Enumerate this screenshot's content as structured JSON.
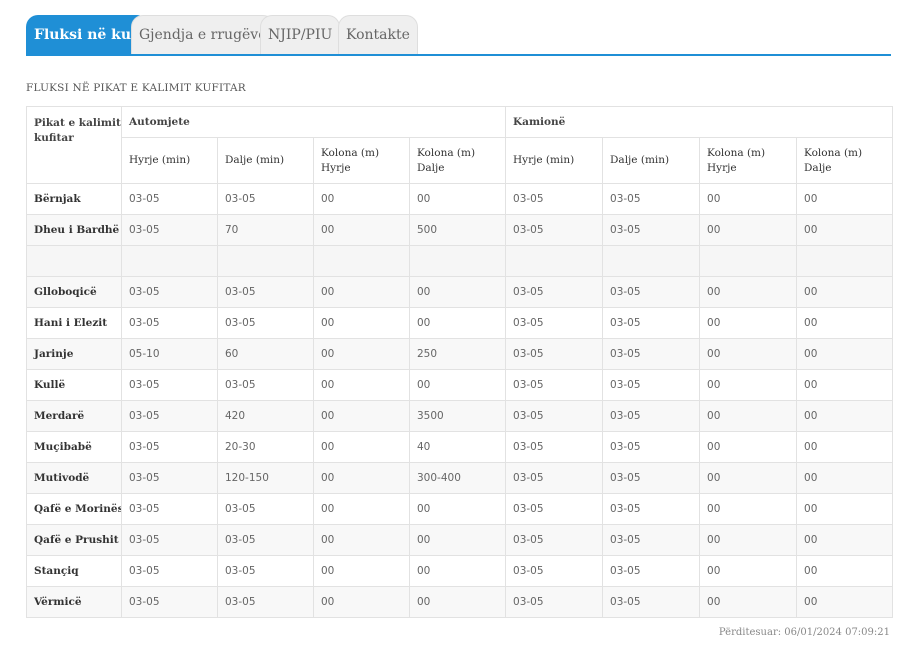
{
  "tabs": [
    {
      "label": "Fluksi në kufi",
      "active": true
    },
    {
      "label": "Gjendja e rrugëve",
      "active": false
    },
    {
      "label": "NJIP/PIU",
      "active": false
    },
    {
      "label": "Kontakte",
      "active": false
    }
  ],
  "section_title": "FLUKSI NË PIKAT E KALIMIT KUFITAR",
  "table": {
    "row_header": "Pikat e kalimit kufitar",
    "group_headers": [
      "Automjete",
      "Kamionë"
    ],
    "sub_headers": [
      "Hyrje (min)",
      "Dalje (min)",
      "Kolona (m) Hyrje",
      "Kolona (m) Dalje",
      "Hyrje (min)",
      "Dalje (min)",
      "Kolona (m) Hyrje",
      "Kolona (m) Dalje"
    ],
    "rows": [
      {
        "name": "Bërnjak",
        "values": [
          "03-05",
          "03-05",
          "00",
          "00",
          "03-05",
          "03-05",
          "00",
          "00"
        ]
      },
      {
        "name": "Dheu i Bardhë",
        "values": [
          "03-05",
          "70",
          "00",
          "500",
          "03-05",
          "03-05",
          "00",
          "00"
        ]
      },
      {
        "name": "",
        "values": [
          "",
          "",
          "",
          "",
          "",
          "",
          "",
          ""
        ]
      },
      {
        "name": "Glloboqicë",
        "values": [
          "03-05",
          "03-05",
          "00",
          "00",
          "03-05",
          "03-05",
          "00",
          "00"
        ]
      },
      {
        "name": "Hani i Elezit",
        "values": [
          "03-05",
          "03-05",
          "00",
          "00",
          "03-05",
          "03-05",
          "00",
          "00"
        ]
      },
      {
        "name": "Jarinje",
        "values": [
          "05-10",
          "60",
          "00",
          "250",
          "03-05",
          "03-05",
          "00",
          "00"
        ]
      },
      {
        "name": "Kullë",
        "values": [
          "03-05",
          "03-05",
          "00",
          "00",
          "03-05",
          "03-05",
          "00",
          "00"
        ]
      },
      {
        "name": "Merdarë",
        "values": [
          "03-05",
          "420",
          "00",
          "3500",
          "03-05",
          "03-05",
          "00",
          "00"
        ]
      },
      {
        "name": "Muçibabë",
        "values": [
          "03-05",
          "20-30",
          "00",
          "40",
          "03-05",
          "03-05",
          "00",
          "00"
        ]
      },
      {
        "name": "Mutivodë",
        "values": [
          "03-05",
          "120-150",
          "00",
          "300-400",
          "03-05",
          "03-05",
          "00",
          "00"
        ]
      },
      {
        "name": "Qafë e Morinës",
        "values": [
          "03-05",
          "03-05",
          "00",
          "00",
          "03-05",
          "03-05",
          "00",
          "00"
        ]
      },
      {
        "name": "Qafë e Prushit",
        "values": [
          "03-05",
          "03-05",
          "00",
          "00",
          "03-05",
          "03-05",
          "00",
          "00"
        ]
      },
      {
        "name": "Stançiq",
        "values": [
          "03-05",
          "03-05",
          "00",
          "00",
          "03-05",
          "03-05",
          "00",
          "00"
        ]
      },
      {
        "name": "Vërmicë",
        "values": [
          "03-05",
          "03-05",
          "00",
          "00",
          "03-05",
          "03-05",
          "00",
          "00"
        ]
      }
    ]
  },
  "updated": "Përditesuar: 06/01/2024 07:09:21",
  "colors": {
    "accent": "#1f8fd6",
    "tab_inactive": "#efefef",
    "border": "#e2e2e2"
  }
}
